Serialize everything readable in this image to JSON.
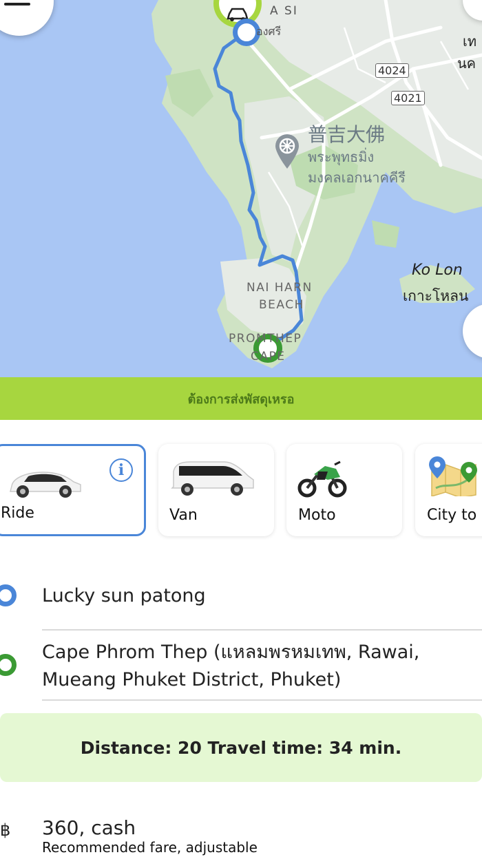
{
  "map": {
    "labels": {
      "patong_latin": "A SI",
      "patong_thai": "องศรี",
      "big_buddha_cn": "普吉大佛",
      "big_buddha_th1": "พระพุทธมิ่ง",
      "big_buddha_th2": "มงคลเอกนาคคีรี",
      "nai_harn_1": "NAI HARN",
      "nai_harn_2": "BEACH",
      "promthep_1": "PROMTHEP",
      "promthep_2": "CAPE",
      "ko_lon_latin": "Ko Lon",
      "ko_lon_thai": "เกาะโหลน",
      "edge_top": "เท",
      "edge_bottom": "นค"
    },
    "road_badges": [
      "4024",
      "4021"
    ],
    "colors": {
      "water": "#a9c6f4",
      "land": "#cfe3c4",
      "urban": "#e7ebe7",
      "route": "#4a86d8",
      "dest": "#3b9a34"
    }
  },
  "banner": {
    "text": "ต้องการส่งพัสดุเหรอ"
  },
  "vehicles": [
    {
      "label": "Ride",
      "icon": "sedan-icon",
      "selected": true
    },
    {
      "label": "Van",
      "icon": "van-icon",
      "selected": false
    },
    {
      "label": "Moto",
      "icon": "motorbike-icon",
      "selected": false
    },
    {
      "label": "City to",
      "icon": "city-map-icon",
      "selected": false
    }
  ],
  "route": {
    "origin": "Lucky sun patong",
    "destination": "Cape Phrom Thep (แหลมพรหมเทพ, Rawai, Mueang Phuket District, Phuket)"
  },
  "trip_info": "Distance: 20 Travel time: 34 min.",
  "fare": {
    "currency_symbol": "฿",
    "value": "360, cash",
    "note": "Recommended fare, adjustable"
  }
}
